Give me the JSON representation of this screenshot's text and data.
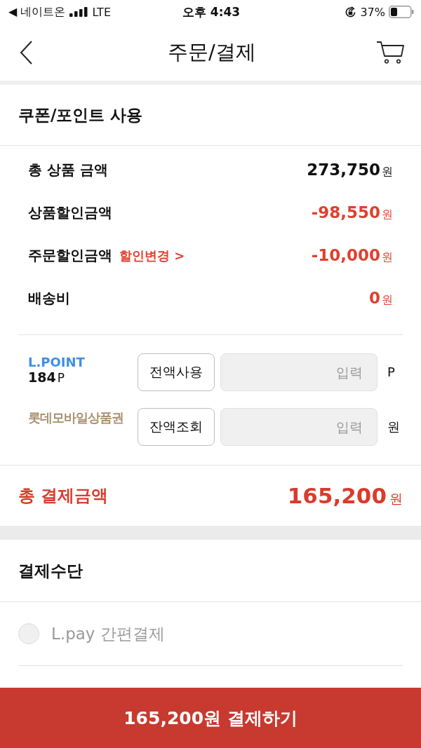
{
  "status_bar": {
    "carrier": "◀ 네이트온",
    "network": "LTE",
    "time": "오후 4:43",
    "battery": "37%"
  },
  "header": {
    "title": "주문/결제"
  },
  "coupon_section": {
    "title": "쿠폰/포인트 사용"
  },
  "summary": [
    {
      "label": "총 상품 금액",
      "amount": "**273,750**원",
      "kind": "plain"
    },
    {
      "label": "상품할인금액",
      "amount": "**-98,550**원",
      "kind": "deduction"
    },
    {
      "label": "주문할인금액",
      "link": "할인변경 >",
      "amount": "**-10,000**원",
      "kind": "deduction"
    },
    {
      "label": "배송비",
      "amount": "**0**원",
      "kind": "deduction"
    }
  ],
  "points": [
    {
      "kind": "lpoint",
      "name": "L.POINT",
      "balance": "**184**P",
      "button": "전액사용",
      "placeholder": "입력",
      "unit": "P"
    },
    {
      "kind": "giftcard",
      "name": "롯데모바일상품권",
      "button": "잔액조회",
      "placeholder": "입력",
      "unit": "원"
    }
  ],
  "total": {
    "label": "총 결제금액",
    "amount": "**165,200**원"
  },
  "payment_section": {
    "title": "결제수단",
    "methods": [
      {
        "label": "L.pay 간편결제",
        "selected": false
      }
    ]
  },
  "pay_button": {
    "label": "165,200원 결제하기"
  }
}
